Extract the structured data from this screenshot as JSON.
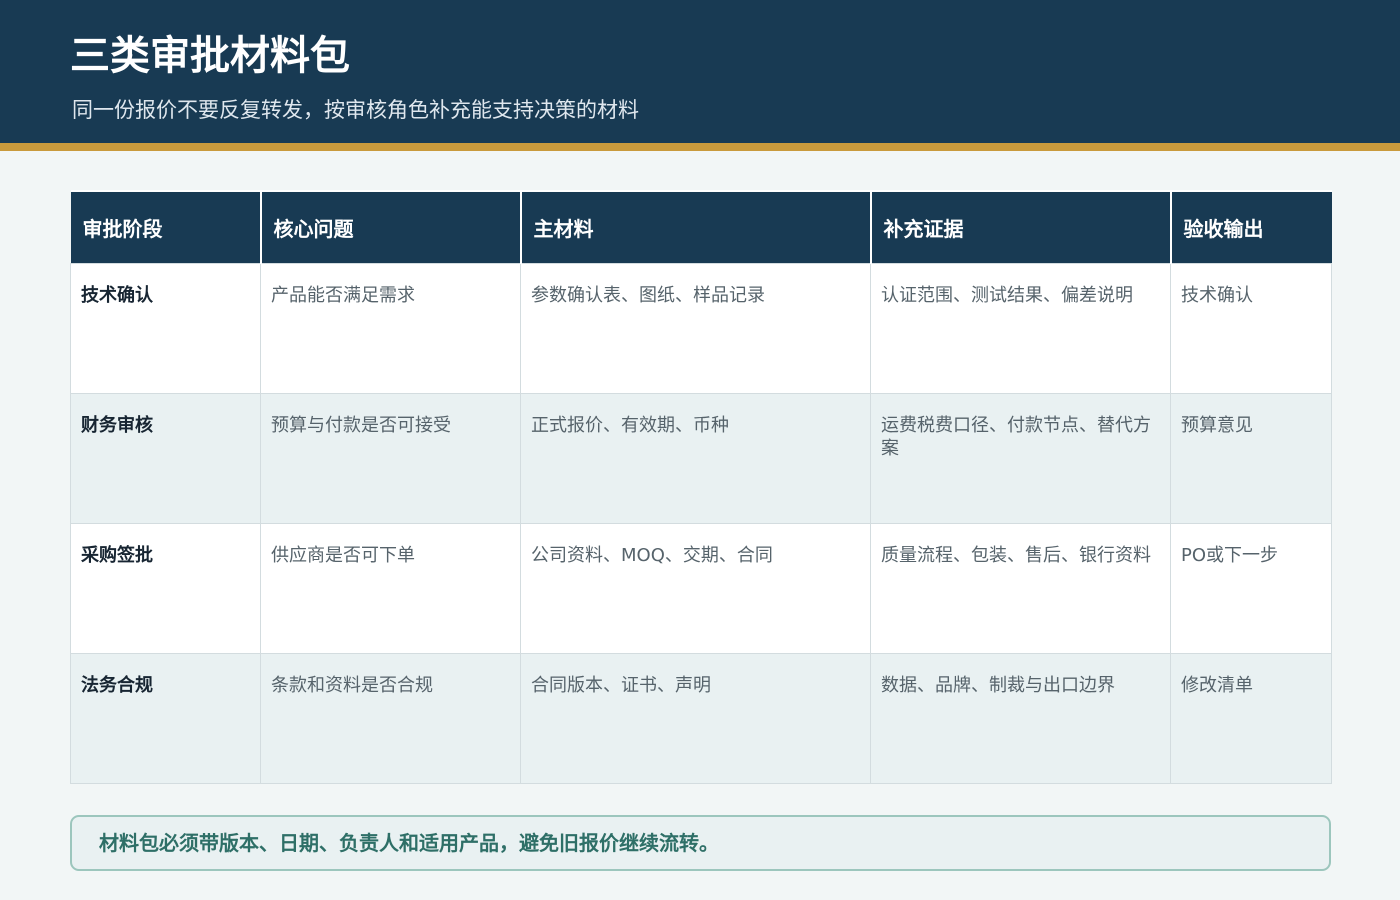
{
  "header": {
    "title": "三类审批材料包",
    "subtitle": "同一份报价不要反复转发，按审核角色补充能支持决策的材料"
  },
  "table": {
    "columns": [
      "审批阶段",
      "核心问题",
      "主材料",
      "补充证据",
      "验收输出"
    ],
    "rows": [
      [
        "技术确认",
        "产品能否满足需求",
        "参数确认表、图纸、样品记录",
        "认证范围、测试结果、偏差说明",
        "技术确认"
      ],
      [
        "财务审核",
        "预算与付款是否可接受",
        "正式报价、有效期、币种",
        "运费税费口径、付款节点、替代方案",
        "预算意见"
      ],
      [
        "采购签批",
        "供应商是否可下单",
        "公司资料、MOQ、交期、合同",
        "质量流程、包装、售后、银行资料",
        "PO或下一步"
      ],
      [
        "法务合规",
        "条款和资料是否合规",
        "合同版本、证书、声明",
        "数据、品牌、制裁与出口边界",
        "修改清单"
      ]
    ]
  },
  "note": {
    "text": "材料包必须带版本、日期、负责人和适用产品，避免旧报价继续流转。"
  },
  "colors": {
    "header_bg": "#183a53",
    "accent_rule": "#c99a3c",
    "note_text": "#2e6f67",
    "note_border": "#9cc6bd"
  }
}
